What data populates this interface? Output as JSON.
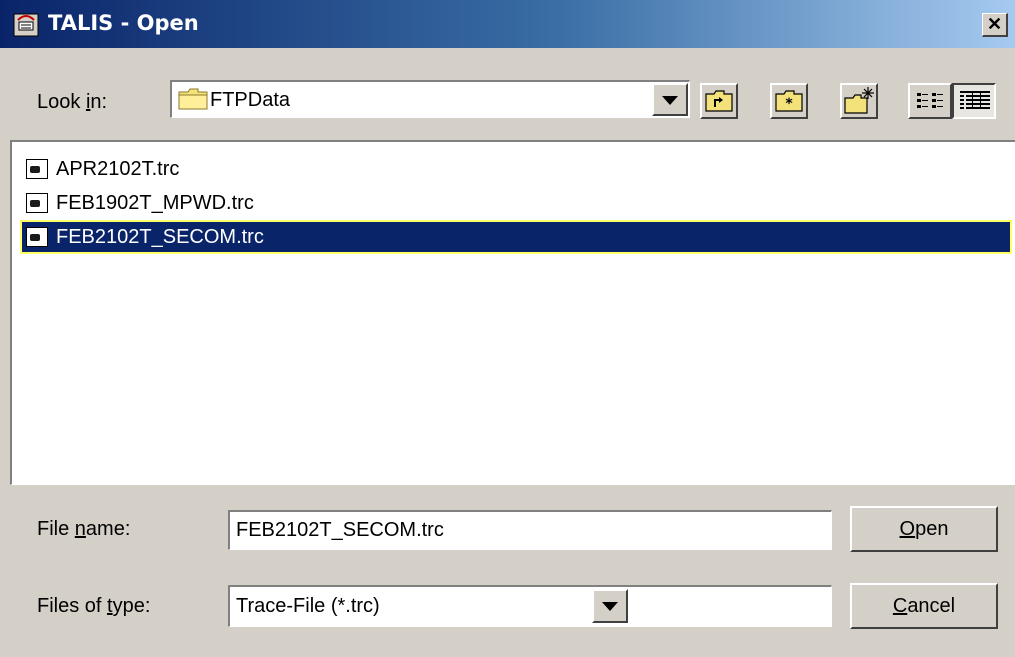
{
  "window": {
    "title": "TALIS - Open",
    "close_glyph": "✕"
  },
  "look_in": {
    "label_pre": "Look ",
    "label_mnemonic": "i",
    "label_post": "n:",
    "value": "FTPData",
    "icon": "folder-icon"
  },
  "toolbar": {
    "buttons": [
      {
        "name": "up-one-level",
        "icon": "folder-up-icon"
      },
      {
        "name": "home",
        "icon": "home-folder-icon"
      },
      {
        "name": "create-new-folder",
        "icon": "new-folder-icon"
      },
      {
        "name": "list-view",
        "icon": "list-view-icon"
      },
      {
        "name": "details-view",
        "icon": "details-view-icon"
      }
    ]
  },
  "files": [
    {
      "name": "APR2102T.trc",
      "selected": false
    },
    {
      "name": "FEB1902T_MPWD.trc",
      "selected": false
    },
    {
      "name": "FEB2102T_SECOM.trc",
      "selected": true
    }
  ],
  "file_name": {
    "label_pre": "File ",
    "label_mnemonic": "n",
    "label_post": "ame:",
    "value": "FEB2102T_SECOM.trc"
  },
  "file_type": {
    "label_pre": "Files of ",
    "label_mnemonic": "t",
    "label_post": "ype:",
    "value": "Trace-File (*.trc)"
  },
  "buttons": {
    "open_mnemonic": "O",
    "open_rest": "pen",
    "cancel_mnemonic": "C",
    "cancel_rest": "ancel"
  },
  "colors": {
    "title_bar": "#0a246a",
    "selection": "#0a246a",
    "selection_border": "#ffff66",
    "window_bg": "#d4d0c8"
  }
}
